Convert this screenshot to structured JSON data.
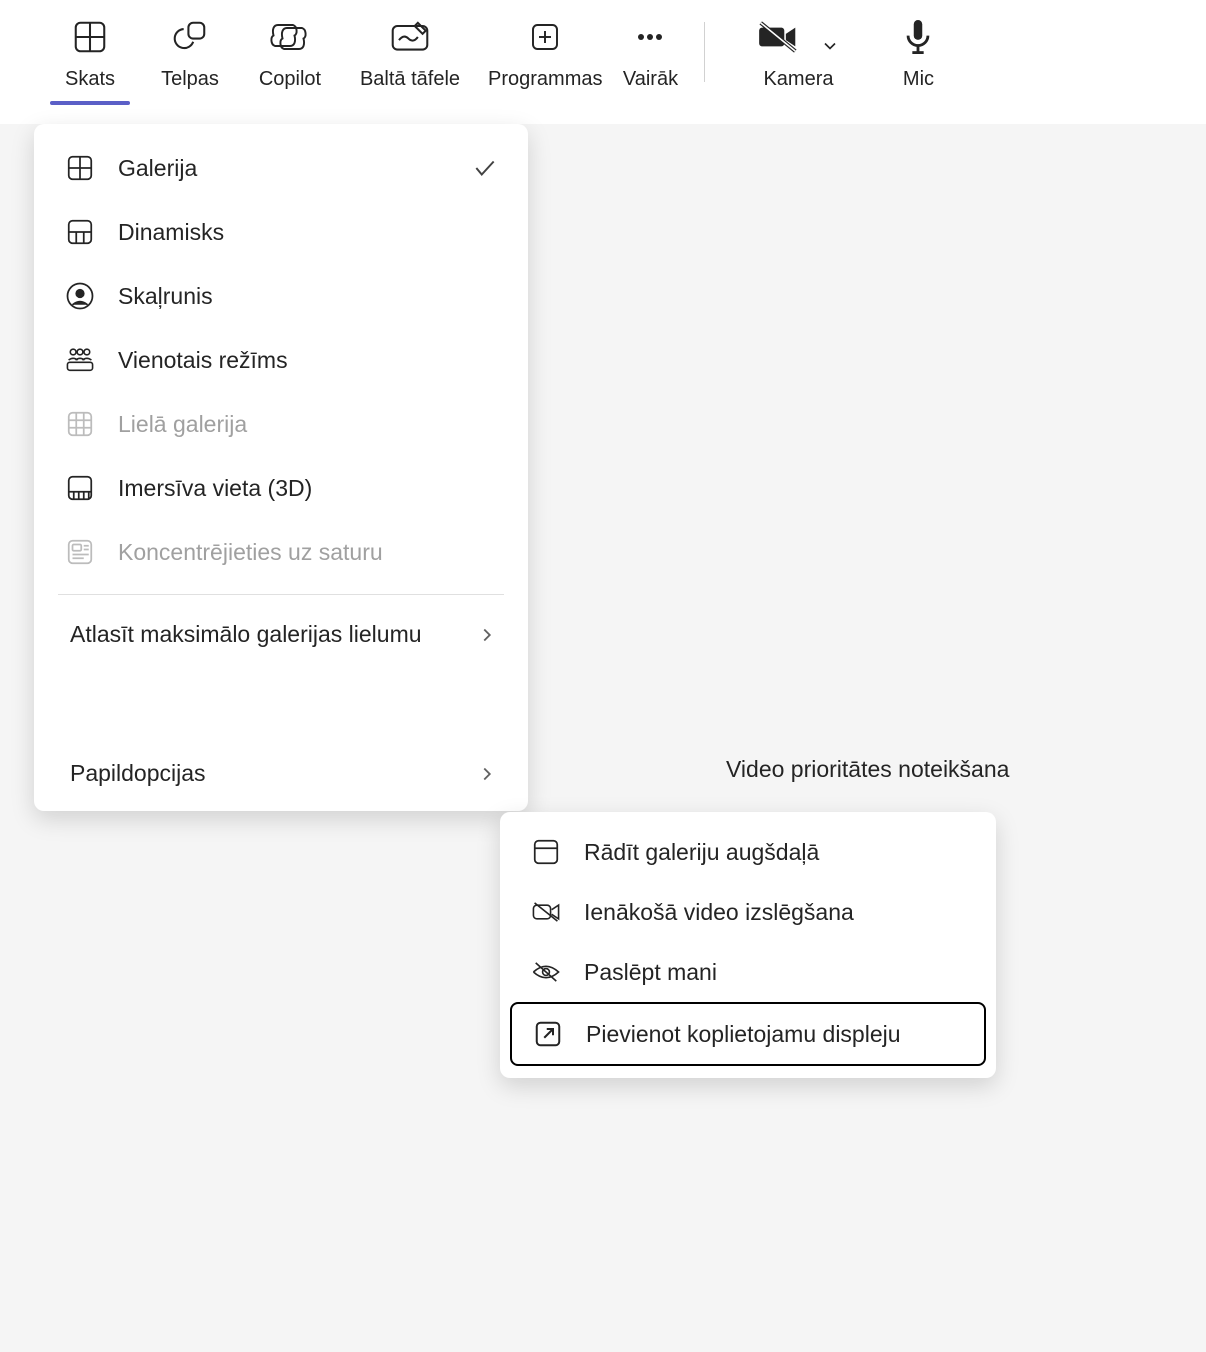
{
  "toolbar": {
    "view": "Skats",
    "rooms": "Telpas",
    "copilot": "Copilot",
    "whiteboard": "Baltā tāfele",
    "apps": "Programmas",
    "more": "Vairāk",
    "camera": "Kamera",
    "mic": "Mic"
  },
  "view_menu": {
    "gallery": "Galerija",
    "dynamic": "Dinamisks",
    "speaker": "Skaļrunis",
    "together": "Vienotais režīms",
    "large_gallery": "Lielā galerija",
    "immersive": "Imersīva vieta (3D)",
    "focus_content": "Koncentrējieties uz saturu",
    "select_max": "Atlasīt maksimālo galerijas lielumu",
    "more_options": "Papildopcijas"
  },
  "content_label": "Video prioritātes noteikšana",
  "submenu": {
    "show_top": "Rādīt galeriju augšdaļā",
    "incoming_off": "Ienākošā video izslēgšana",
    "hide_me": "Paslēpt mani",
    "add_display": "Pievienot koplietojamu displeju"
  }
}
